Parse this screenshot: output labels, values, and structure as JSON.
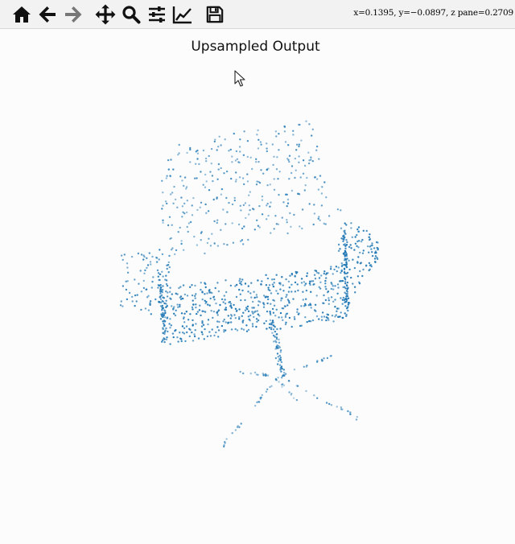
{
  "toolbar": {
    "buttons": [
      {
        "name": "home-button",
        "icon": "home-icon"
      },
      {
        "name": "back-button",
        "icon": "arrow-left-icon"
      },
      {
        "name": "forward-button",
        "icon": "arrow-right-icon"
      },
      {
        "name": "pan-button",
        "icon": "move-icon"
      },
      {
        "name": "zoom-button",
        "icon": "magnifier-icon"
      },
      {
        "name": "configure-subplots-button",
        "icon": "sliders-icon"
      },
      {
        "name": "edit-axis-button",
        "icon": "line-chart-icon"
      },
      {
        "name": "save-button",
        "icon": "floppy-disk-icon"
      }
    ],
    "coords_text": "x=0.1395, y=−0.0897, z pane=0.2709"
  },
  "plot": {
    "title": "Upsampled Output",
    "point_color": "#1f77b4"
  },
  "chart_data": {
    "type": "scatter",
    "title": "Upsampled Output",
    "projection": "3d",
    "axes_visible": false,
    "grid": false,
    "series": [
      {
        "marker_color": "#1f77b4",
        "approx_point_count": 1400
      }
    ]
  }
}
